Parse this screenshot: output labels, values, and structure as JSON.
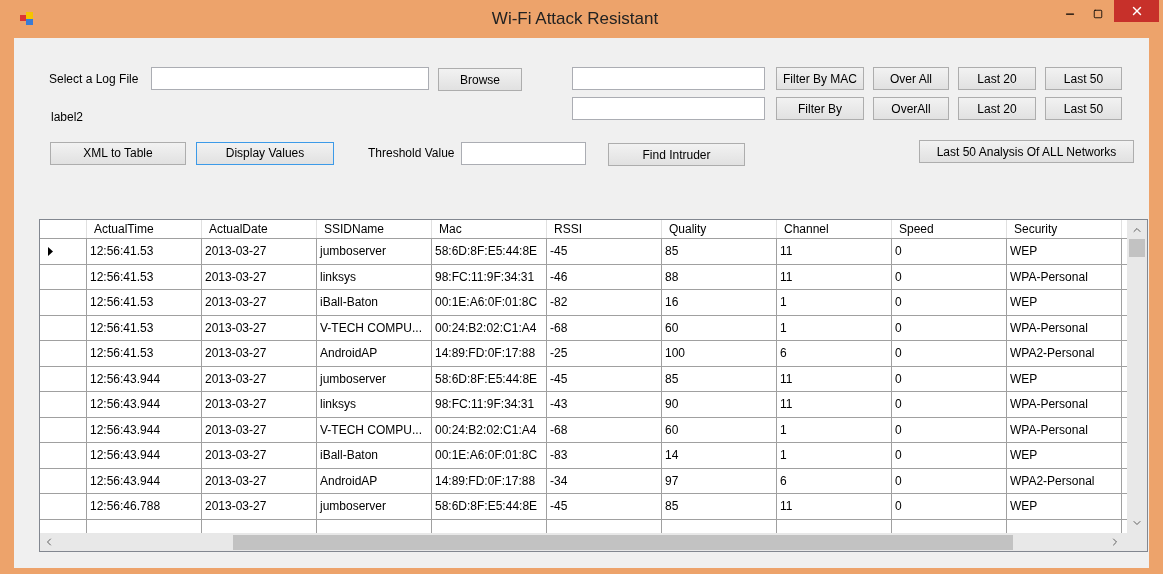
{
  "window": {
    "title": "Wi-Fi Attack Resistant"
  },
  "log_file": {
    "label": "Select a Log File",
    "browse": "Browse"
  },
  "status_label": "label2",
  "filters": [
    {
      "filter": "Filter By MAC",
      "overall": "Over All",
      "last20": "Last 20",
      "last50": "Last 50"
    },
    {
      "filter": "Filter By",
      "overall": "OverAll",
      "last20": "Last 20",
      "last50": "Last 50"
    }
  ],
  "actions": {
    "xml_to_table": "XML to Table",
    "display_values": "Display Values",
    "display_values_focused": true,
    "threshold_label": "Threshold Value",
    "find_intruder": "Find Intruder",
    "analysis": "Last 50 Analysis Of ALL Networks"
  },
  "table": {
    "columns": [
      "ActualTime",
      "ActualDate",
      "SSIDName",
      "Mac",
      "RSSI",
      "Quality",
      "Channel",
      "Speed",
      "Security"
    ],
    "rows": [
      {
        "current": true,
        "cells": [
          "12:56:41.53",
          "2013-03-27",
          "jumboserver",
          "58:6D:8F:E5:44:8E",
          "-45",
          "85",
          "11",
          "0",
          "WEP"
        ]
      },
      {
        "current": false,
        "cells": [
          "12:56:41.53",
          "2013-03-27",
          "linksys",
          "98:FC:11:9F:34:31",
          "-46",
          "88",
          "11",
          "0",
          "WPA-Personal"
        ]
      },
      {
        "current": false,
        "cells": [
          "12:56:41.53",
          "2013-03-27",
          "iBall-Baton",
          "00:1E:A6:0F:01:8C",
          "-82",
          "16",
          "1",
          "0",
          "WEP"
        ]
      },
      {
        "current": false,
        "cells": [
          "12:56:41.53",
          "2013-03-27",
          "V-TECH COMPU...",
          "00:24:B2:02:C1:A4",
          "-68",
          "60",
          "1",
          "0",
          "WPA-Personal"
        ]
      },
      {
        "current": false,
        "cells": [
          "12:56:41.53",
          "2013-03-27",
          "AndroidAP",
          "14:89:FD:0F:17:88",
          "-25",
          "100",
          "6",
          "0",
          "WPA2-Personal"
        ]
      },
      {
        "current": false,
        "cells": [
          "12:56:43.944",
          "2013-03-27",
          "jumboserver",
          "58:6D:8F:E5:44:8E",
          "-45",
          "85",
          "11",
          "0",
          "WEP"
        ]
      },
      {
        "current": false,
        "cells": [
          "12:56:43.944",
          "2013-03-27",
          "linksys",
          "98:FC:11:9F:34:31",
          "-43",
          "90",
          "11",
          "0",
          "WPA-Personal"
        ]
      },
      {
        "current": false,
        "cells": [
          "12:56:43.944",
          "2013-03-27",
          "V-TECH COMPU...",
          "00:24:B2:02:C1:A4",
          "-68",
          "60",
          "1",
          "0",
          "WPA-Personal"
        ]
      },
      {
        "current": false,
        "cells": [
          "12:56:43.944",
          "2013-03-27",
          "iBall-Baton",
          "00:1E:A6:0F:01:8C",
          "-83",
          "14",
          "1",
          "0",
          "WEP"
        ]
      },
      {
        "current": false,
        "cells": [
          "12:56:43.944",
          "2013-03-27",
          "AndroidAP",
          "14:89:FD:0F:17:88",
          "-34",
          "97",
          "6",
          "0",
          "WPA2-Personal"
        ]
      },
      {
        "current": false,
        "cells": [
          "12:56:46.788",
          "2013-03-27",
          "jumboserver",
          "58:6D:8F:E5:44:8E",
          "-45",
          "85",
          "11",
          "0",
          "WEP"
        ]
      }
    ]
  }
}
